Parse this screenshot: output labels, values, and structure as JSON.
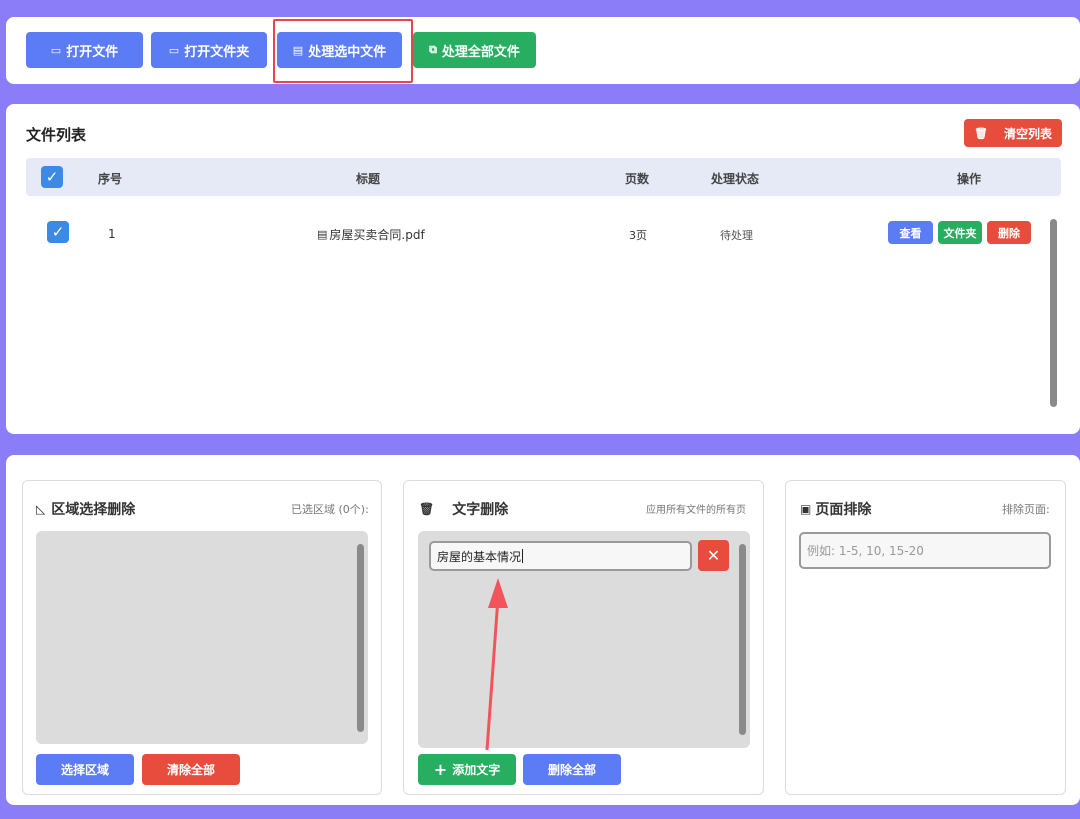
{
  "toolbar": {
    "open_file": "打开文件",
    "open_folder": "打开文件夹",
    "process_selected": "处理选中文件",
    "process_all": "处理全部文件"
  },
  "file_list": {
    "title": "文件列表",
    "clear_button": "清空列表",
    "columns": [
      "序号",
      "标题",
      "页数",
      "处理状态",
      "操作"
    ],
    "rows": [
      {
        "checked": true,
        "index": "1",
        "title": "房屋买卖合同.pdf",
        "pages": "3页",
        "status": "待处理",
        "actions": [
          "查看",
          "文件夹",
          "删除"
        ]
      }
    ]
  },
  "region_delete": {
    "title": "区域选择删除",
    "note": "已选区域 (0个):",
    "select_button": "选择区域",
    "clear_button": "清除全部"
  },
  "text_delete": {
    "title": "文字删除",
    "note": "应用所有文件的所有页",
    "input_value": "房屋的基本情况",
    "add_button": "添加文字",
    "delete_all_button": "删除全部"
  },
  "page_exclude": {
    "title": "页面排除",
    "note": "排除页面:",
    "placeholder": "例如: 1-5, 10, 15-20"
  },
  "colors": {
    "background": "#8b7cf8",
    "primary": "#5b7cf4",
    "success": "#27ae60",
    "danger": "#e74c3c",
    "highlight": "#e8444f"
  }
}
